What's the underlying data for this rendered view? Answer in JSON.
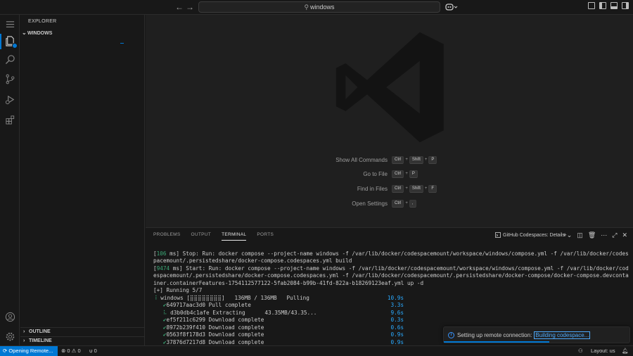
{
  "titlebar": {
    "back_icon": "arrow-left-icon",
    "forward_icon": "arrow-right-icon",
    "search_value": "windows",
    "search_icon": "search-icon",
    "copilot_icon": "copilot-icon"
  },
  "activity": {
    "items": [
      "explorer-icon",
      "search-icon",
      "source-control-icon",
      "run-debug-icon",
      "extensions-icon"
    ],
    "bottom": [
      "account-icon",
      "settings-gear-icon"
    ]
  },
  "sidebar": {
    "title": "EXPLORER",
    "folder": "WINDOWS",
    "outline": "OUTLINE",
    "timeline": "TIMELINE"
  },
  "editor": {
    "hints": [
      {
        "label": "Show All Commands",
        "keys": [
          "Ctrl",
          "Shift",
          "P"
        ]
      },
      {
        "label": "Go to File",
        "keys": [
          "Ctrl",
          "P"
        ]
      },
      {
        "label": "Find in Files",
        "keys": [
          "Ctrl",
          "Shift",
          "F"
        ]
      },
      {
        "label": "Open Settings",
        "keys": [
          "Ctrl",
          ","
        ]
      }
    ]
  },
  "panel": {
    "tabs": [
      "PROBLEMS",
      "OUTPUT",
      "TERMINAL",
      "PORTS"
    ],
    "active_tab": "TERMINAL",
    "terminal_name": "GitHub Codespaces: Details",
    "lines": {
      "l1a": "[",
      "l1n": "106",
      "l1b": " ms] Stop: Run: docker compose --project-name windows -f /var/lib/docker/codespacemount/workspace/windows/compose.yml -f /var/lib/docker/codes",
      "l2": "pacemount/.persistedshare/docker-compose.codespaces.yml build",
      "l3a": "[",
      "l3n": "9474",
      "l3b": " ms] Start: Run: docker compose --project-name windows -f /var/lib/docker/codespacemount/workspace/windows/compose.yml -f /var/lib/docker/cod",
      "l4": "espacemount/.persistedshare/docker-compose.codespaces.yml -f /var/lib/docker/codespacemount/.persistedshare/docker-compose/docker-compose.devconta",
      "l5": "iner.containerFeatures-1754112577122-5fab2084-b99b-41fd-822a-b18269123eaf.yml up -d",
      "l6": "[+] Running 5/7"
    },
    "rows": [
      {
        "mark": "⠸",
        "text": " windows [⣿⣿⣿⣿⣿⣿⣿⣿]   136MB / 136MB   Pulling",
        "time": "10.9s"
      },
      {
        "mark": "   ✔",
        "text": "649717aac3d0 Pull complete",
        "time": "3.3s"
      },
      {
        "mark": "   ⠧",
        "text": " d3b0db4c1afe Extracting      43.35MB/43.35...",
        "time": "9.6s"
      },
      {
        "mark": "   ✔",
        "text": "ef5f211c6299 Download complete",
        "time": "0.3s"
      },
      {
        "mark": "   ✔",
        "text": "8972b239f410 Download complete",
        "time": "0.6s"
      },
      {
        "mark": "   ✔",
        "text": "0563f8f178d3 Download complete",
        "time": "0.9s"
      },
      {
        "mark": "   ✔",
        "text": "37876d7217d8 Download complete",
        "time": "0.9s"
      }
    ]
  },
  "notification": {
    "message": "Setting up remote connection:",
    "link": "Building codespace..."
  },
  "statusbar": {
    "remote": "Opening Remote...",
    "errors": "0",
    "warnings": "0",
    "ports": "0",
    "layout": "Layout: us"
  },
  "colors": {
    "accent": "#0078d4",
    "background": "#181818",
    "editor": "#1f1f1f"
  }
}
